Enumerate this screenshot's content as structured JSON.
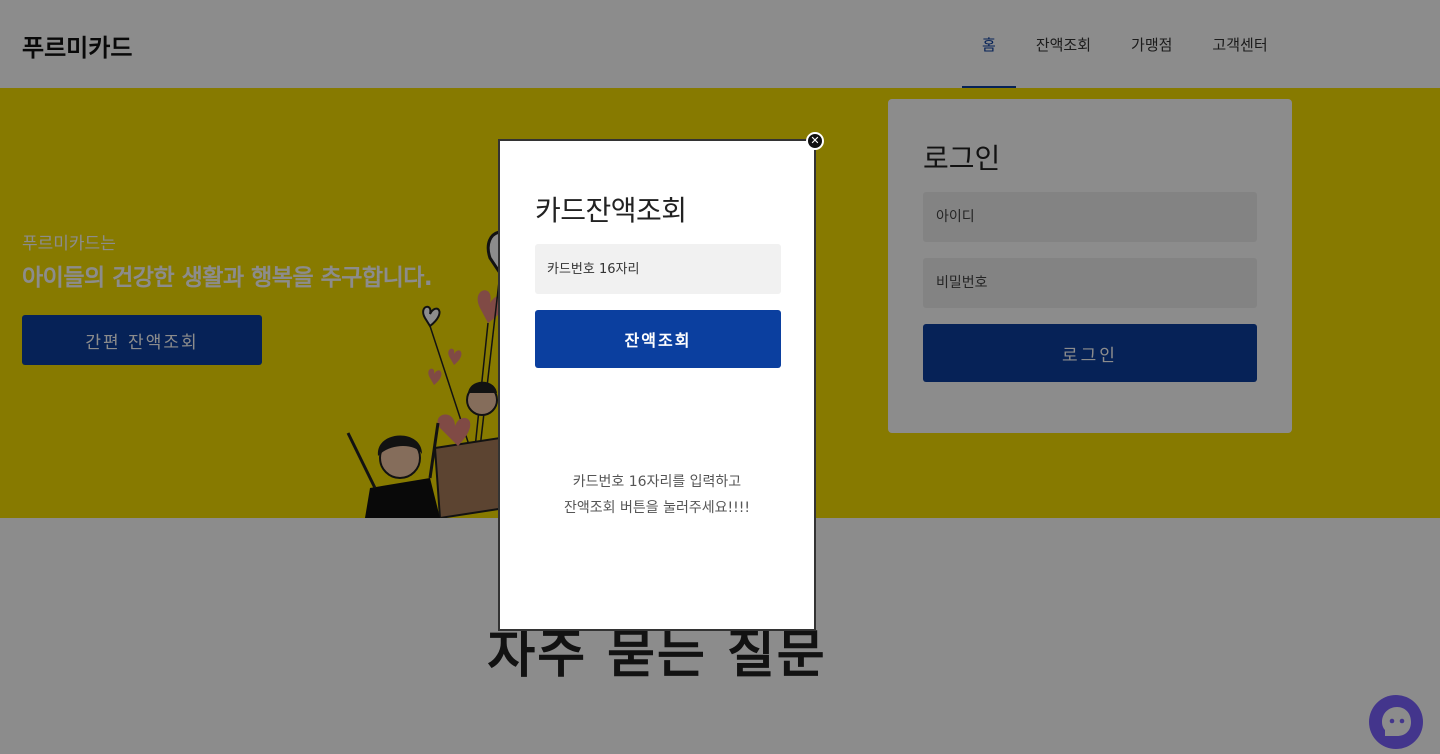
{
  "header": {
    "logo": "푸르미카드",
    "nav": [
      {
        "label": "홈",
        "active": true
      },
      {
        "label": "잔액조회",
        "active": false
      },
      {
        "label": "가맹점",
        "active": false
      },
      {
        "label": "고객센터",
        "active": false
      }
    ]
  },
  "hero": {
    "subtitle": "푸르미카드는",
    "title": "아이들의 건강한 생활과 행복을 추구합니다.",
    "button_label": "간편 잔액조회"
  },
  "login": {
    "title": "로그인",
    "id_placeholder": "아이디",
    "pw_placeholder": "비밀번호",
    "button_label": "로그인"
  },
  "faq": {
    "title": "자주 묻는 질문"
  },
  "modal": {
    "title": "카드잔액조회",
    "input_placeholder": "카드번호 16자리",
    "button_label": "잔액조회",
    "help_line1": "카드번호 16자리를 입력하고",
    "help_line2": "잔액조회 버튼을 눌러주세요!!!!",
    "close_icon": "close-icon"
  },
  "chat": {
    "icon": "chat-icon"
  },
  "colors": {
    "primary": "#0b3f9f",
    "hero_bg": "#f6df00",
    "overlay": "rgba(0,0,0,0.45)",
    "chat": "#7b61ff"
  }
}
